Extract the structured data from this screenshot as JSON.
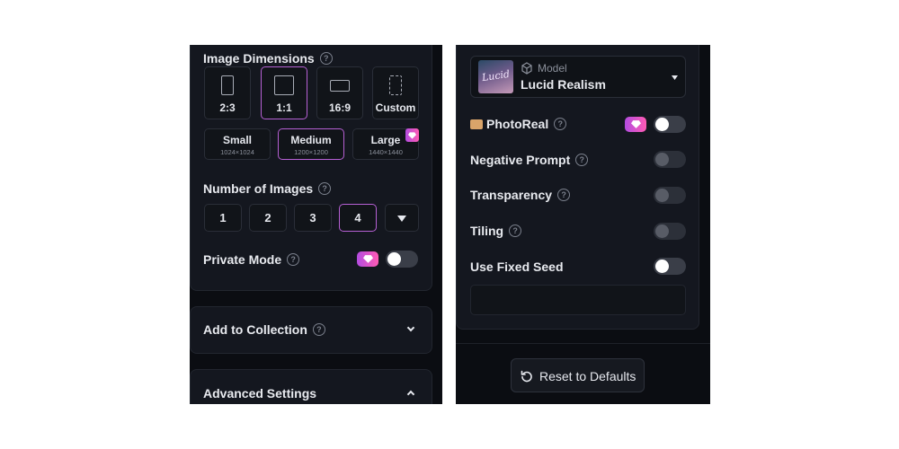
{
  "left": {
    "image_dimensions": {
      "title": "Image Dimensions",
      "ratios": [
        {
          "label": "2:3",
          "selected": false
        },
        {
          "label": "1:1",
          "selected": true
        },
        {
          "label": "16:9",
          "selected": false
        },
        {
          "label": "Custom",
          "selected": false
        }
      ],
      "sizes": [
        {
          "label": "Small",
          "res": "1024×1024",
          "selected": false
        },
        {
          "label": "Medium",
          "res": "1200×1200",
          "selected": true
        },
        {
          "label": "Large",
          "res": "1440×1440",
          "selected": false,
          "premium": true
        }
      ]
    },
    "number_of_images": {
      "title": "Number of Images",
      "options": [
        "1",
        "2",
        "3",
        "4"
      ],
      "selected": "4"
    },
    "private_mode": {
      "label": "Private Mode",
      "enabled": false
    },
    "add_to_collection": {
      "label": "Add to Collection"
    },
    "advanced_settings": {
      "label": "Advanced Settings"
    }
  },
  "right": {
    "model": {
      "caption": "Model",
      "name": "Lucid Realism",
      "thumb_text": "Lucid"
    },
    "photoreal": {
      "label": "PhotoReal",
      "enabled": false
    },
    "negative_prompt": {
      "label": "Negative Prompt",
      "enabled": false
    },
    "transparency": {
      "label": "Transparency",
      "enabled": false
    },
    "tiling": {
      "label": "Tiling",
      "enabled": false
    },
    "fixed_seed": {
      "label": "Use Fixed Seed",
      "enabled": false
    },
    "reset": {
      "label": "Reset to Defaults"
    }
  },
  "colors": {
    "accent": "#b660d4",
    "premium_gradient_start": "#b34ce0",
    "premium_gradient_end": "#ff5bb4",
    "background": "#0b0d12"
  }
}
